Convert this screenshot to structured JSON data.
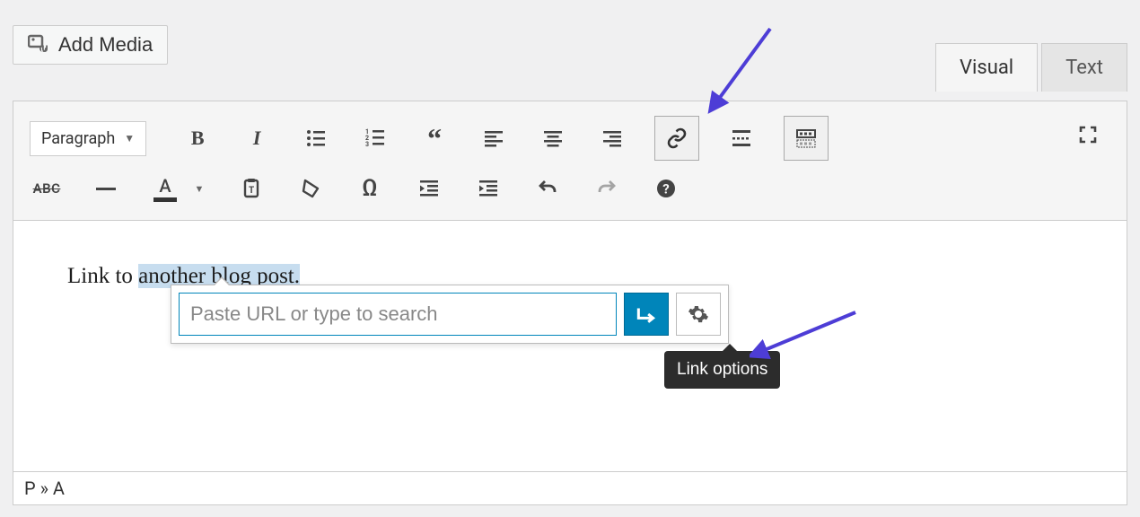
{
  "header": {
    "add_media": "Add Media"
  },
  "tabs": {
    "visual": "Visual",
    "text": "Text",
    "active": "visual"
  },
  "toolbar": {
    "format_label": "Paragraph"
  },
  "editor": {
    "text_before": "Link to ",
    "text_highlighted": "another blog post.",
    "text_after": ""
  },
  "link_popup": {
    "placeholder": "Paste URL or type to search",
    "value": ""
  },
  "tooltip": {
    "link_options": "Link options"
  },
  "footer": {
    "path": "P » A"
  }
}
